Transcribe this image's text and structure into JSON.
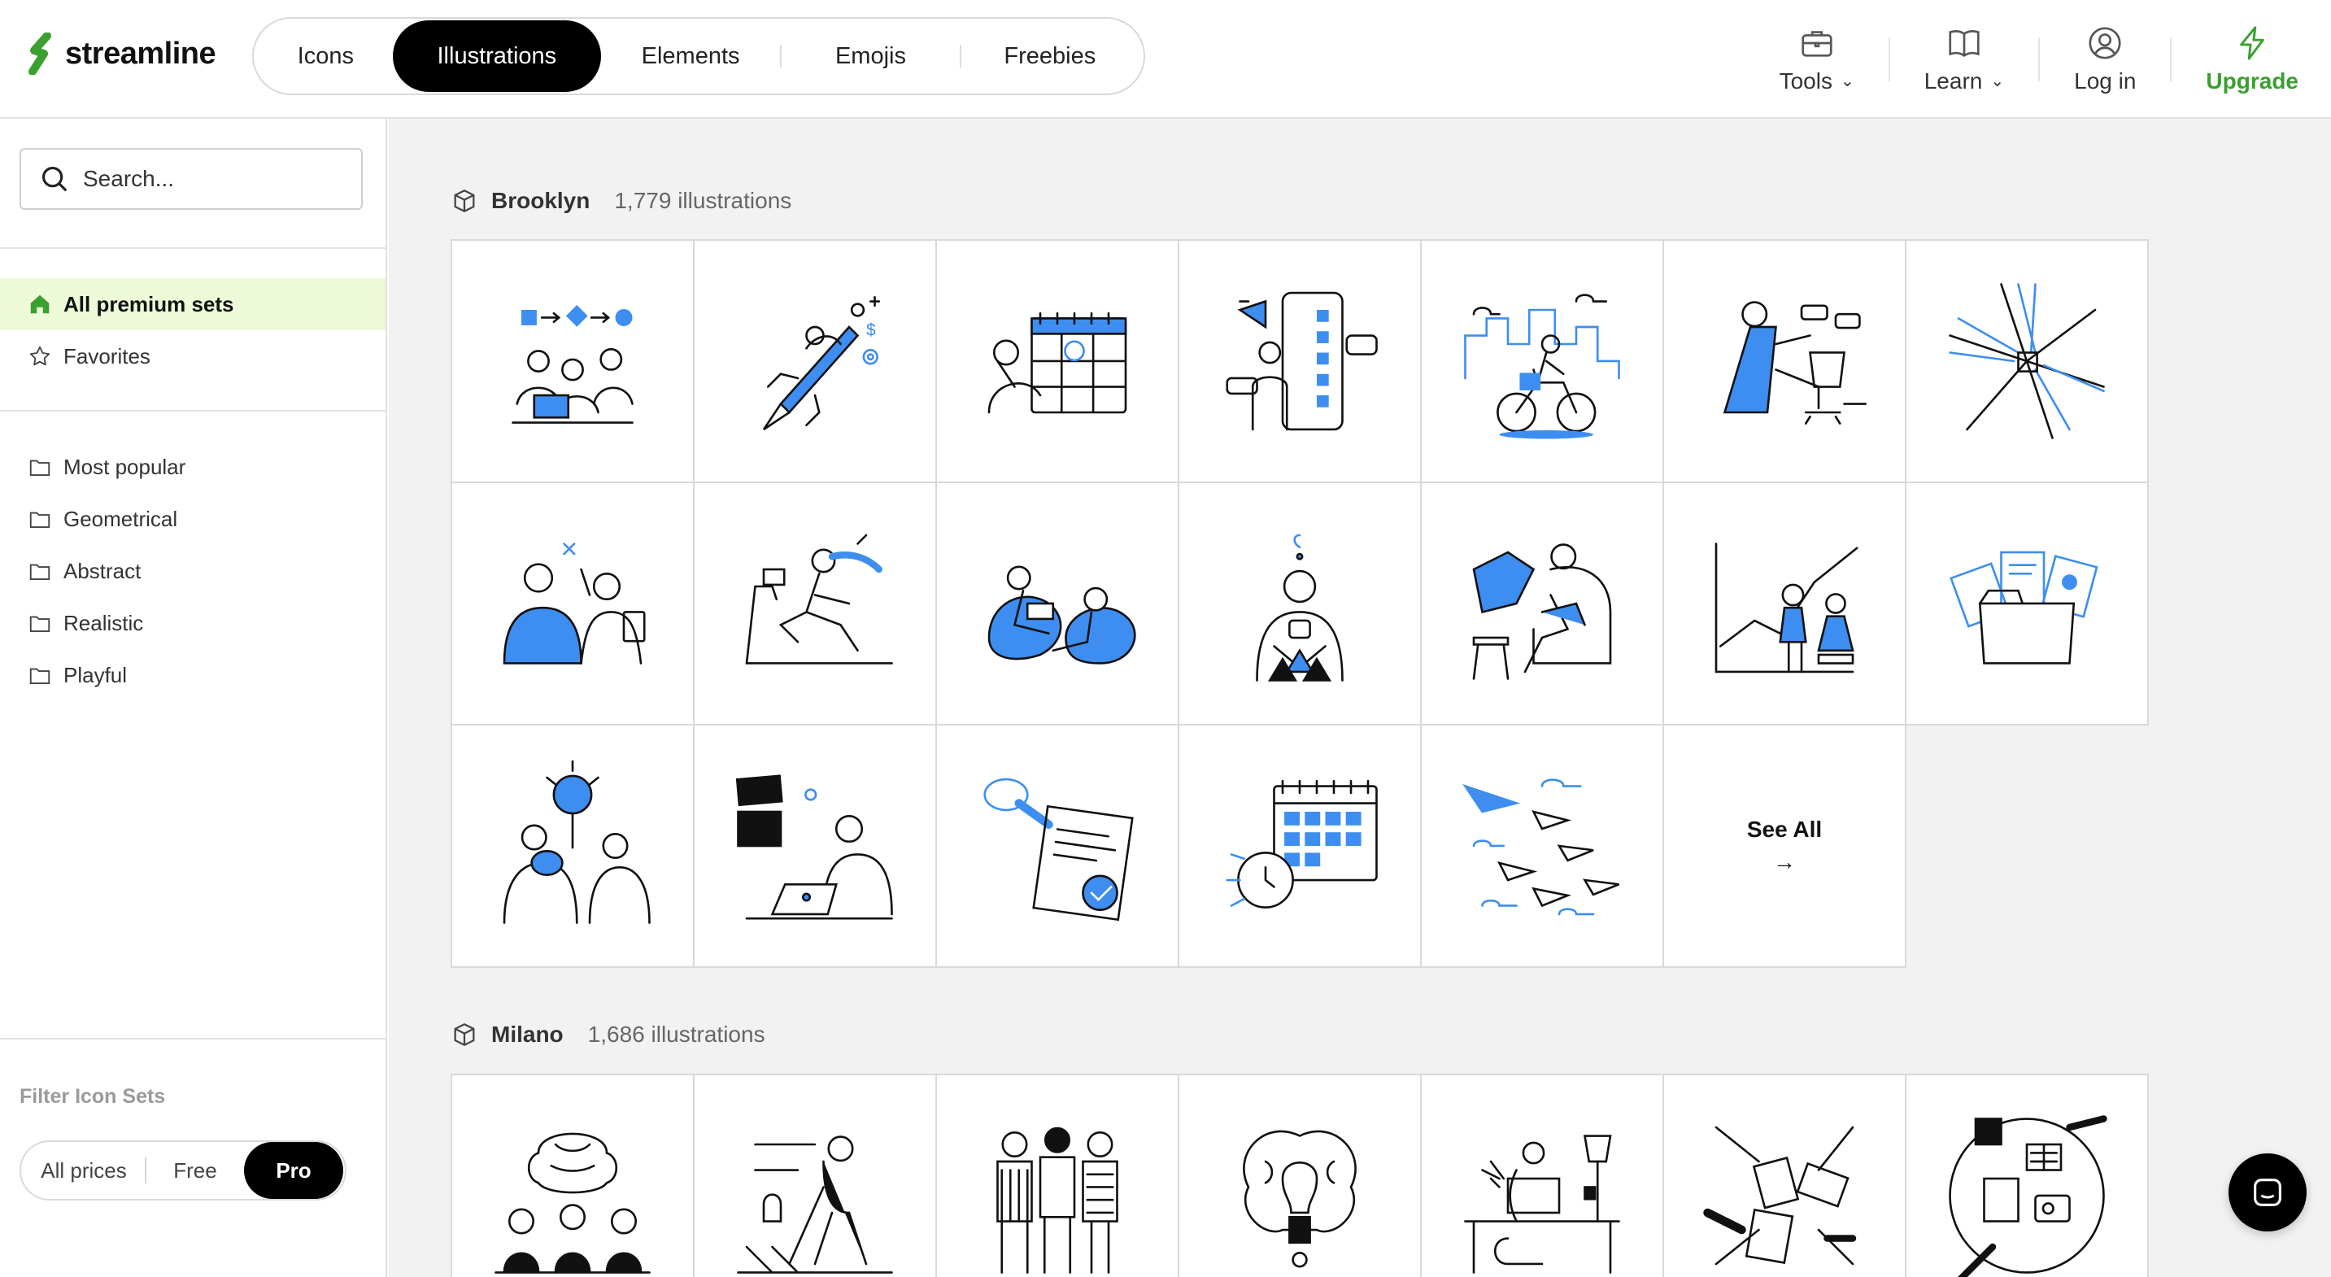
{
  "brand": {
    "name": "streamline",
    "accent": "#3aa02e",
    "illustration_blue": "#3d8ef0"
  },
  "nav": {
    "tabs": [
      {
        "label": "Icons",
        "active": false
      },
      {
        "label": "Illustrations",
        "active": true
      },
      {
        "label": "Elements",
        "active": false
      },
      {
        "label": "Emojis",
        "active": false
      },
      {
        "label": "Freebies",
        "active": false
      }
    ]
  },
  "header_right": {
    "tools": {
      "label": "Tools",
      "icon": "briefcase-icon"
    },
    "learn": {
      "label": "Learn",
      "icon": "book-icon"
    },
    "login": {
      "label": "Log in",
      "icon": "user-circle-icon"
    },
    "upgrade": {
      "label": "Upgrade",
      "icon": "lightning-icon"
    }
  },
  "sidebar": {
    "search": {
      "placeholder": "Search..."
    },
    "primary": [
      {
        "label": "All premium sets",
        "icon": "home-icon",
        "active": true
      },
      {
        "label": "Favorites",
        "icon": "star-icon",
        "active": false
      }
    ],
    "categories": [
      {
        "label": "Most popular",
        "icon": "folder-icon"
      },
      {
        "label": "Geometrical",
        "icon": "folder-icon"
      },
      {
        "label": "Abstract",
        "icon": "folder-icon"
      },
      {
        "label": "Realistic",
        "icon": "folder-icon"
      },
      {
        "label": "Playful",
        "icon": "folder-icon"
      }
    ],
    "filter_title": "Filter Icon Sets",
    "price_filter": [
      {
        "label": "All prices",
        "active": false
      },
      {
        "label": "Free",
        "active": false
      },
      {
        "label": "Pro",
        "active": true
      }
    ]
  },
  "sets": [
    {
      "name": "Brooklyn",
      "count": "1,779 illustrations",
      "icon": "box-icon",
      "thumbnails": [
        "team-shapes-illustration",
        "rocket-launch-illustration",
        "calendar-illustration",
        "mobile-megaphone-illustration",
        "city-bike-illustration",
        "office-chair-illustration",
        "hands-together-illustration",
        "conversation-illustration",
        "treadmill-illustration",
        "beanbag-chat-illustration",
        "idea-person-illustration",
        "armchair-laptop-illustration",
        "growth-chart-illustration",
        "folder-documents-illustration",
        "lightbulb-team-illustration",
        "laptop-work-illustration",
        "approval-stamp-illustration",
        "alarm-calendar-illustration",
        "paper-planes-illustration"
      ],
      "see_all": {
        "label": "See All",
        "arrow": "→"
      }
    },
    {
      "name": "Milano",
      "count": "1,686 illustrations",
      "icon": "box-icon",
      "thumbnails": [
        "brainstorm-illustration",
        "vacuum-cleaning-illustration",
        "three-people-illustration",
        "brain-bulb-illustration",
        "desk-work-illustration",
        "desk-tools-illustration",
        "collaboration-table-illustration"
      ]
    }
  ],
  "chat": {
    "icon": "chat-icon"
  }
}
